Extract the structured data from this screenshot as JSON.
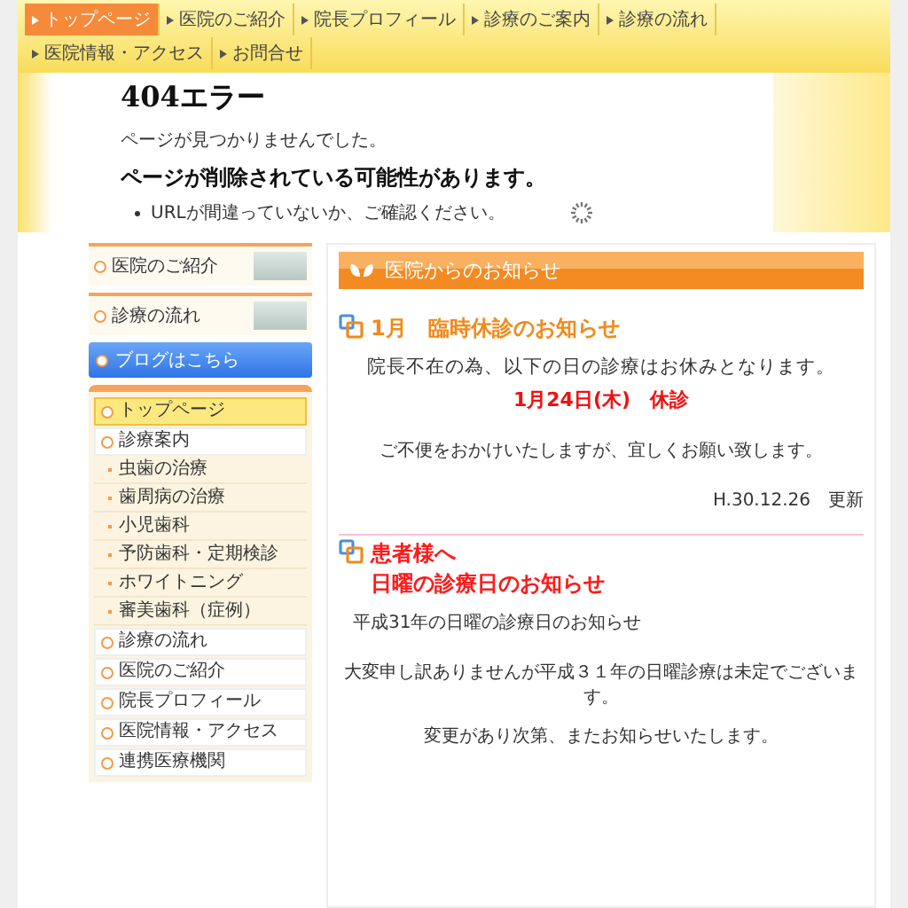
{
  "nav": [
    {
      "label": "トップページ",
      "selected": true
    },
    {
      "label": "医院のご紹介",
      "selected": false
    },
    {
      "label": "院長プロフィール",
      "selected": false
    },
    {
      "label": "診療のご案内",
      "selected": false
    },
    {
      "label": "診療の流れ",
      "selected": false
    },
    {
      "label": "医院情報・アクセス",
      "selected": false
    },
    {
      "label": "お問合せ",
      "selected": false
    }
  ],
  "error": {
    "title": "404エラー",
    "message": "ページが見つかりませんでした。",
    "heading": "ページが削除されている可能性があります。",
    "bullets": [
      "URLが間違っていないか、ご確認ください。"
    ]
  },
  "sidebar": {
    "banners": [
      {
        "label": "医院のご紹介"
      },
      {
        "label": "診療の流れ"
      }
    ],
    "blog_button": "ブログはこちら",
    "menu": [
      {
        "label": "トップページ",
        "selected": true
      },
      {
        "label": "診療案内",
        "selected": false,
        "children": [
          {
            "label": "虫歯の治療",
            "selected": false
          },
          {
            "label": "歯周病の治療",
            "selected": false
          },
          {
            "label": "小児歯科",
            "selected": false
          },
          {
            "label": "予防歯科・定期検診",
            "selected": false
          },
          {
            "label": "ホワイトニング",
            "selected": false
          },
          {
            "label": "審美歯科（症例）",
            "selected": false
          }
        ]
      },
      {
        "label": "診療の流れ",
        "selected": false
      },
      {
        "label": "医院のご紹介",
        "selected": false
      },
      {
        "label": "院長プロフィール",
        "selected": false
      },
      {
        "label": "医院情報・アクセス",
        "selected": false
      },
      {
        "label": "連携医療機関",
        "selected": false
      }
    ]
  },
  "main": {
    "title": "医院からのお知らせ",
    "notices": [
      {
        "title_lines": [
          "1月　臨時休診のお知らせ"
        ],
        "color": "#f08a1c",
        "blocks": [
          {
            "kind": "lead",
            "text": "院長不在の為、以下の日の診療はお休みとなります。"
          },
          {
            "kind": "highlight",
            "text": "1月24日(木)　休診"
          },
          {
            "kind": "note",
            "text": "ご不便をおかけいたしますが、宜しくお願い致します。"
          },
          {
            "kind": "date",
            "text": "H.30.12.26　更新"
          }
        ]
      },
      {
        "title_lines": [
          "患者様へ",
          "日曜の診療日のお知らせ"
        ],
        "color": "#ff1a1a",
        "blocks": [
          {
            "kind": "intro",
            "text": "平成31年の日曜の診療日のお知らせ"
          },
          {
            "kind": "note",
            "text": "大変申し訳ありませんが平成３１年の日曜診療は未定でございます。"
          },
          {
            "kind": "note",
            "text": "変更があり次第、またお知らせいたします。"
          }
        ]
      }
    ]
  }
}
